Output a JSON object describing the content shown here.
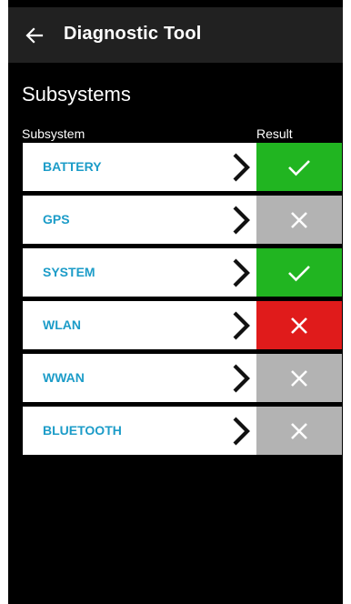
{
  "app_bar": {
    "title": "Diagnostic Tool",
    "back_icon": "arrow-left-icon"
  },
  "section": {
    "title": "Subsystems"
  },
  "columns": {
    "subsystem": "Subsystem",
    "result": "Result"
  },
  "rows": [
    {
      "label": "BATTERY",
      "result": "pass"
    },
    {
      "label": "GPS",
      "result": "not-run"
    },
    {
      "label": "SYSTEM",
      "result": "pass"
    },
    {
      "label": "WLAN",
      "result": "fail"
    },
    {
      "label": "WWAN",
      "result": "not-run"
    },
    {
      "label": "BLUETOOTH",
      "result": "not-run"
    }
  ],
  "colors": {
    "pass": "#21b521",
    "fail": "#e01b1b",
    "not_run": "#b3b3b3",
    "label": "#1c9cc8",
    "app_bar": "#212121",
    "background": "#000000"
  },
  "icons": {
    "pass": "check-icon",
    "fail": "close-icon",
    "not_run": "close-icon",
    "row_action": "chevron-right-icon"
  }
}
